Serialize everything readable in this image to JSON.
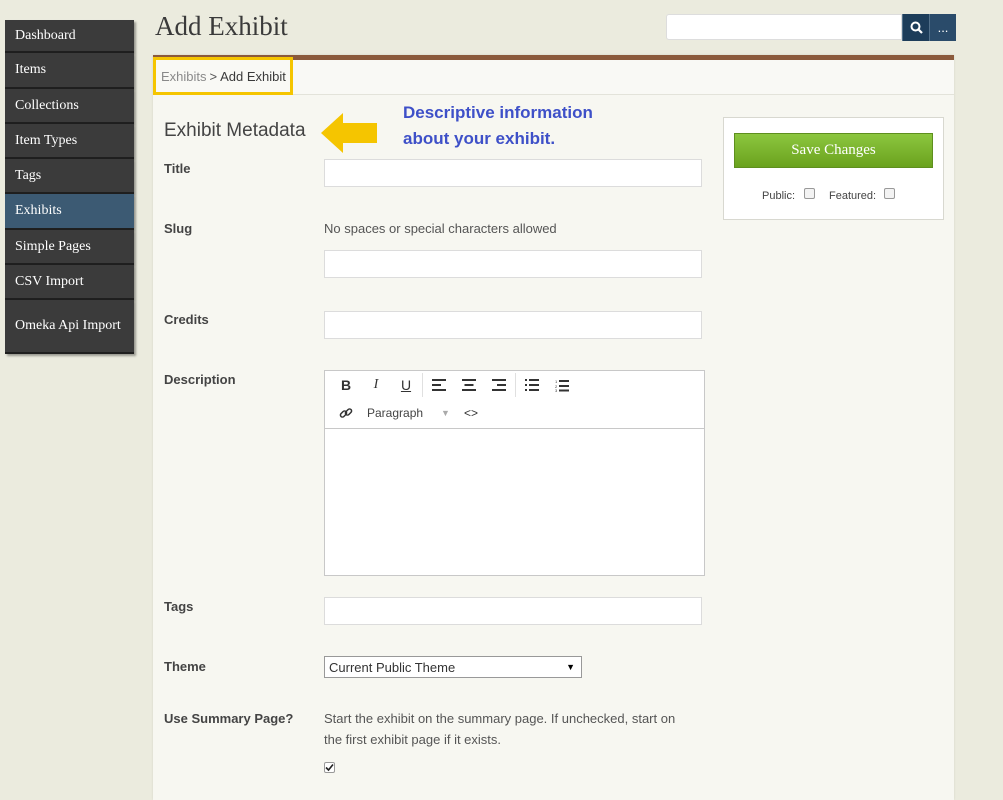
{
  "sidebar": {
    "items": [
      {
        "label": "Dashboard"
      },
      {
        "label": "Items"
      },
      {
        "label": "Collections"
      },
      {
        "label": "Item Types"
      },
      {
        "label": "Tags"
      },
      {
        "label": "Exhibits",
        "active": true
      },
      {
        "label": "Simple Pages"
      },
      {
        "label": "CSV Import"
      },
      {
        "label": "Omeka Api Import"
      }
    ]
  },
  "header": {
    "title": "Add Exhibit",
    "search": {
      "placeholder": "",
      "button_icon": "search-icon",
      "more_label": "..."
    }
  },
  "breadcrumb": {
    "link": "Exhibits",
    "separator": ">",
    "current": "Add Exhibit"
  },
  "section": {
    "title": "Exhibit Metadata"
  },
  "annotation": {
    "line1": "Descriptive information",
    "line2": "about your exhibit."
  },
  "form": {
    "title_label": "Title",
    "slug_label": "Slug",
    "slug_hint": "No spaces or special characters allowed",
    "credits_label": "Credits",
    "description_label": "Description",
    "editor": {
      "format": "Paragraph"
    },
    "tags_label": "Tags",
    "theme_label": "Theme",
    "theme_value": "Current Public Theme",
    "summary_label": "Use Summary Page?",
    "summary_hint_1": "Start the exhibit on the summary page. If unchecked, start on",
    "summary_hint_2": "the first exhibit page if it exists.",
    "summary_checked": true
  },
  "save_panel": {
    "save_label": "Save Changes",
    "public_label": "Public:",
    "featured_label": "Featured:"
  },
  "colors": {
    "accent_brown": "#8b5a3c",
    "nav_active": "#3c5a73",
    "save_green": "#7bb52e",
    "annotation_blue": "#3e50c8",
    "highlight_yellow": "#f5c500"
  }
}
